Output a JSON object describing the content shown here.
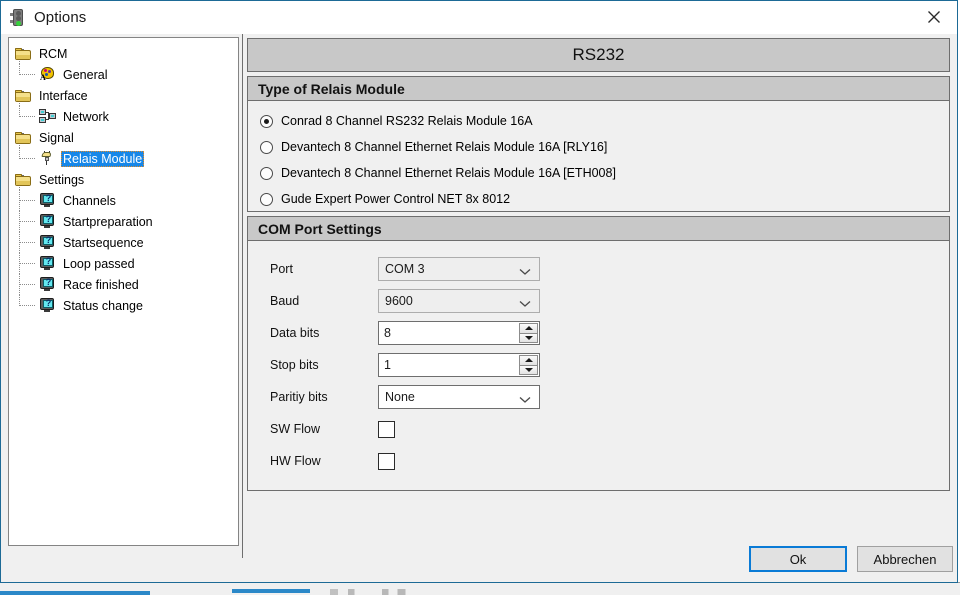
{
  "window": {
    "title": "Options",
    "icon": "traffic-light-icon",
    "close_label": "×"
  },
  "tree": {
    "nodes": [
      {
        "label": "RCM",
        "icon": "folder-icon",
        "level": 0,
        "expander": true
      },
      {
        "label": "General",
        "icon": "palette-icon",
        "level": 1,
        "expander": false
      },
      {
        "label": "Interface",
        "icon": "folder-icon",
        "level": 0,
        "expander": true
      },
      {
        "label": "Network",
        "icon": "network-icon",
        "level": 1,
        "expander": false
      },
      {
        "label": "Signal",
        "icon": "folder-icon",
        "level": 0,
        "expander": true
      },
      {
        "label": "Relais Module",
        "icon": "plug-icon",
        "level": 1,
        "expander": false,
        "selected": true
      },
      {
        "label": "Settings",
        "icon": "folder-icon",
        "level": 0,
        "expander": true
      },
      {
        "label": "Channels",
        "icon": "question-monitor-icon",
        "level": 1,
        "expander": false
      },
      {
        "label": "Startpreparation",
        "icon": "question-monitor-icon",
        "level": 1,
        "expander": false
      },
      {
        "label": "Startsequence",
        "icon": "question-monitor-icon",
        "level": 1,
        "expander": false
      },
      {
        "label": "Loop passed",
        "icon": "question-monitor-icon",
        "level": 1,
        "expander": false
      },
      {
        "label": "Race finished",
        "icon": "question-monitor-icon",
        "level": 1,
        "expander": false
      },
      {
        "label": "Status change",
        "icon": "question-monitor-icon",
        "level": 1,
        "expander": false
      }
    ]
  },
  "panel": {
    "title": "RS232",
    "relais_section": {
      "header": "Type of Relais Module",
      "options": [
        {
          "label": "Conrad 8 Channel RS232 Relais Module 16A",
          "selected": true
        },
        {
          "label": "Devantech 8 Channel Ethernet Relais Module 16A [RLY16]",
          "selected": false
        },
        {
          "label": "Devantech 8 Channel Ethernet Relais Module 16A [ETH008]",
          "selected": false
        },
        {
          "label": "Gude Expert Power Control NET 8x 8012",
          "selected": false
        }
      ]
    },
    "com_section": {
      "header": "COM Port Settings",
      "fields": [
        {
          "label": "Port",
          "type": "combo",
          "value": "COM 3",
          "enabled": false
        },
        {
          "label": "Baud",
          "type": "combo",
          "value": "9600",
          "enabled": false
        },
        {
          "label": "Data bits",
          "type": "spinner",
          "value": "8",
          "enabled": true
        },
        {
          "label": "Stop bits",
          "type": "spinner",
          "value": "1",
          "enabled": true
        },
        {
          "label": "Paritiy bits",
          "type": "combo",
          "value": "None",
          "enabled": true
        },
        {
          "label": "SW Flow",
          "type": "checkbox",
          "value": "",
          "checked": false
        },
        {
          "label": "HW Flow",
          "type": "checkbox",
          "value": "",
          "checked": false
        }
      ]
    }
  },
  "footer": {
    "ok_label": "Ok",
    "cancel_label": "Abbrechen"
  },
  "colors": {
    "selection_blue": "#1787e8",
    "focus_blue": "#0a7bd6",
    "section_gray": "#c8c8c8",
    "window_border": "#1d6a96"
  }
}
